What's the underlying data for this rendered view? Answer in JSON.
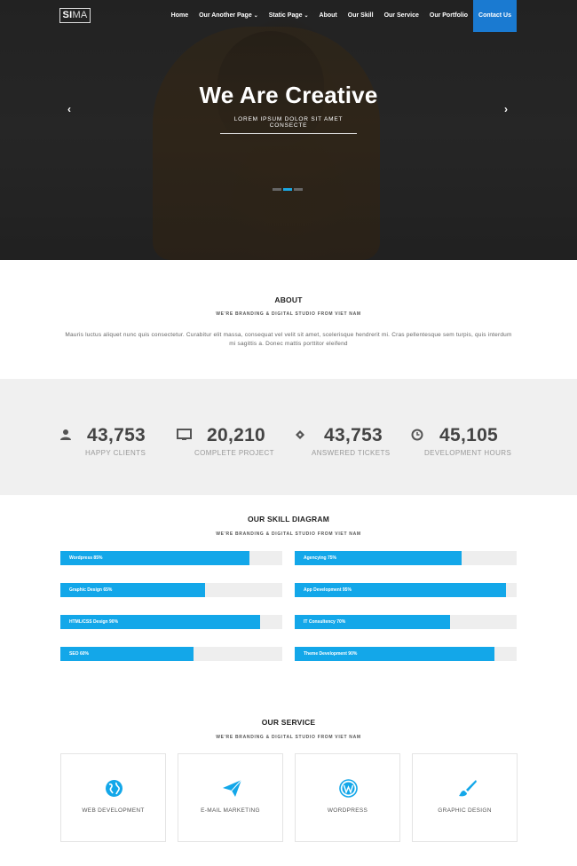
{
  "logo": {
    "part1": "SI",
    "part2": "MA"
  },
  "nav": {
    "items": [
      {
        "label": "Home",
        "caret": false
      },
      {
        "label": "Our Another Page",
        "caret": true
      },
      {
        "label": "Static Page",
        "caret": true
      },
      {
        "label": "About",
        "caret": false
      },
      {
        "label": "Our Skill",
        "caret": false
      },
      {
        "label": "Our Service",
        "caret": false
      },
      {
        "label": "Our Portfolio",
        "caret": false
      },
      {
        "label": "Contact Us",
        "caret": false
      }
    ],
    "caret": "⌄"
  },
  "hero": {
    "title": "We Are Creative",
    "subtitle": "LOREM IPSUM DOLOR SIT AMET CONSECTE",
    "prev": "‹",
    "next": "›",
    "slides": 3,
    "active_slide": 2
  },
  "about": {
    "title": "ABOUT",
    "tagline": "WE'RE BRANDING & DIGITAL STUDIO FROM VIET NAM",
    "text": "Mauris luctus aliquet nunc quis consectetur. Curabitur elit massa, consequat vel velit sit amet, scelerisque hendrerit mi. Cras pellentesque sem turpis, quis interdum mi sagittis a. Donec mattis porttitor eleifend"
  },
  "stats": [
    {
      "icon": "user-icon",
      "value": "43,753",
      "label": "HAPPY CLIENTS"
    },
    {
      "icon": "monitor-icon",
      "value": "20,210",
      "label": "COMPLETE PROJECT"
    },
    {
      "icon": "ticket-icon",
      "value": "43,753",
      "label": "ANSWERED TICKETS"
    },
    {
      "icon": "clock-icon",
      "value": "45,105",
      "label": "DEVELOPMENT HOURS"
    }
  ],
  "skills": {
    "title": "OUR SKILL DIAGRAM",
    "tagline": "WE'RE BRANDING & DIGITAL STUDIO FROM VIET NAM",
    "left": [
      {
        "label": "Wordpress 85%",
        "percent": 85
      },
      {
        "label": "Graphic Design 65%",
        "percent": 65
      },
      {
        "label": "HTML/CSS Design 90%",
        "percent": 90
      },
      {
        "label": "SEO 60%",
        "percent": 60
      }
    ],
    "right": [
      {
        "label": "Agencying 75%",
        "percent": 75
      },
      {
        "label": "App Development 95%",
        "percent": 95
      },
      {
        "label": "IT Consultency 70%",
        "percent": 70
      },
      {
        "label": "Theme Development 90%",
        "percent": 90
      }
    ]
  },
  "services": {
    "title": "OUR SERVICE",
    "tagline": "WE'RE BRANDING & DIGITAL STUDIO FROM VIET NAM",
    "items": [
      {
        "icon": "globe-icon",
        "label": "WEB DEVELOPMENT"
      },
      {
        "icon": "paper-plane-icon",
        "label": "E-MAIL MARKETING"
      },
      {
        "icon": "wordpress-icon",
        "label": "WORDPRESS"
      },
      {
        "icon": "paintbrush-icon",
        "label": "GRAPHIC DESIGN"
      }
    ]
  },
  "colors": {
    "accent": "#13a7e9",
    "nav_active": "#1a7ad1",
    "stats_bg": "#f0f0f0"
  }
}
